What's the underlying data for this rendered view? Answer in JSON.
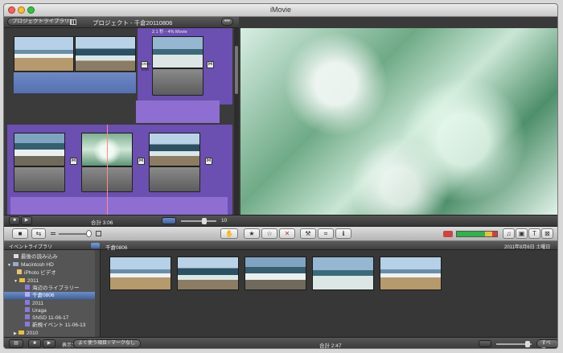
{
  "app": {
    "title": "iMovie"
  },
  "project": {
    "library_button": "プロジェクトライブラリ",
    "title": "プロジェクト - 千倉20110806",
    "more_button": "•••",
    "total_label": "合計 3:06",
    "clip_info": "2.1 秒 - 4% Movie",
    "size_value": "10"
  },
  "event": {
    "library_title": "イベントライブラリ",
    "event_name": "千倉0806",
    "event_date": "2011年8月6日 土曜日",
    "total_label": "合計 2:47",
    "display_label": "表示：",
    "display_value": "よく使う項目 / マークなし",
    "all_button": "すべて"
  },
  "sidebar": {
    "items": [
      {
        "label": "最後の読み込み",
        "indent": 1,
        "icon": "film-strip-icon"
      },
      {
        "label": "Macintosh HD",
        "indent": 0,
        "icon": "hard-drive-icon",
        "arrow": "▼"
      },
      {
        "label": "iPhoto ビデオ",
        "indent": 1,
        "icon": "iphoto-icon"
      },
      {
        "label": "2011",
        "indent": 1,
        "icon": "folder-icon",
        "arrow": "▼"
      },
      {
        "label": "海辺のライブラリー",
        "indent": 2,
        "icon": "event-icon"
      },
      {
        "label": "千倉0806",
        "indent": 2,
        "icon": "event-icon",
        "selected": true
      },
      {
        "label": "2011",
        "indent": 2,
        "icon": "event-icon"
      },
      {
        "label": "Uraga",
        "indent": 2,
        "icon": "event-icon"
      },
      {
        "label": "SNSD 11-06-17",
        "indent": 2,
        "icon": "event-icon"
      },
      {
        "label": "新規イベント 11-06-13",
        "indent": 2,
        "icon": "event-icon"
      },
      {
        "label": "2010",
        "indent": 1,
        "icon": "folder-icon",
        "arrow": "▶"
      }
    ]
  },
  "toolbar": {
    "hand_tool": "hand-icon",
    "favorite": "★",
    "unmark": "☆",
    "reject": "✕",
    "voiceover": "microphone-icon",
    "crop": "crop-icon",
    "info": "ℹ"
  },
  "colors": {
    "accent_purple": "#6b4fb1",
    "audio": "#8e6fd1",
    "selection": "#3f63a3",
    "playhead": "#ff8a8a"
  }
}
